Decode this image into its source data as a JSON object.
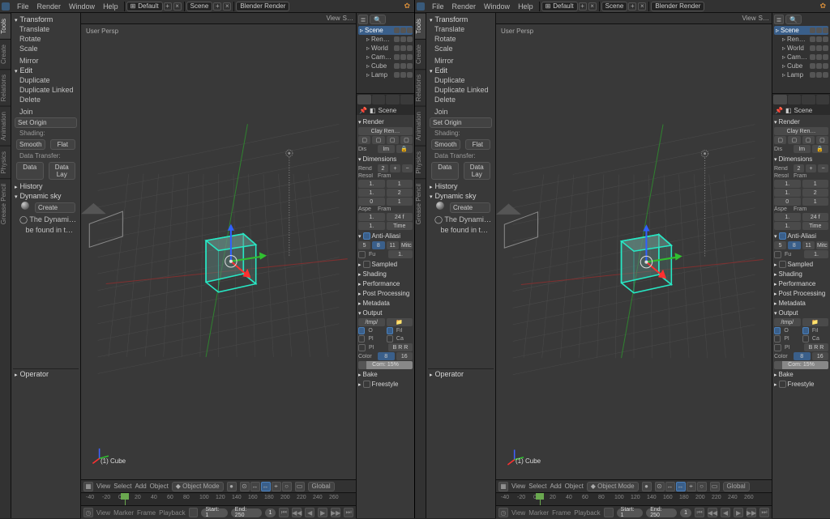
{
  "top": {
    "menus": [
      "File",
      "Render",
      "Window",
      "Help"
    ],
    "layout": "Default",
    "scene": "Scene",
    "engine": "Blender Render"
  },
  "vtabs": [
    "Tools",
    "Create",
    "Relations",
    "Animation",
    "Physics",
    "Grease Pencil"
  ],
  "toolpanel": {
    "transform": {
      "title": "Transform",
      "items": [
        "Translate",
        "Rotate",
        "Scale",
        "",
        "Mirror"
      ]
    },
    "edit": {
      "title": "Edit",
      "items": [
        "Duplicate",
        "Duplicate Linked",
        "Delete",
        "",
        "Join"
      ],
      "setorigin": "Set Origin",
      "shading_label": "Shading:",
      "shading": [
        "Smooth",
        "Flat"
      ],
      "datatransfer": "Data Transfer:",
      "dt": [
        "Data",
        "Data Lay"
      ]
    },
    "history": "History",
    "dynsky": {
      "title": "Dynamic sky",
      "create": "Create",
      "note1": "The Dynamic …",
      "note2": "be found in th…"
    },
    "operator": "Operator"
  },
  "viewport": {
    "hdr_left": "",
    "hdr_view": "View",
    "hdr_right": "",
    "persp": "User Persp",
    "obj": "(1) Cube",
    "footer_menus": [
      "View",
      "Select",
      "Add",
      "Object"
    ],
    "mode": "Object Mode",
    "orient": "Global"
  },
  "timeline": {
    "ticks": [
      -40,
      -20,
      0,
      20,
      40,
      60,
      80,
      100,
      120,
      140,
      160,
      180,
      200,
      220,
      240,
      260
    ],
    "menus": [
      "View",
      "Marker",
      "Frame",
      "Playback"
    ],
    "start_label": "Start:",
    "start": 1,
    "end_label": "End:",
    "end": 250,
    "frame": 1,
    "cursor_pct": 16
  },
  "outliner": {
    "items": [
      {
        "name": "Scene",
        "icon": "scene",
        "sel": true
      },
      {
        "name": "RenderLayers",
        "icon": "layers",
        "indent": 1
      },
      {
        "name": "World",
        "icon": "world",
        "indent": 1
      },
      {
        "name": "Camera",
        "icon": "cam",
        "indent": 1
      },
      {
        "name": "Cube",
        "icon": "mesh",
        "indent": 1
      },
      {
        "name": "Lamp",
        "icon": "lamp",
        "indent": 1
      }
    ]
  },
  "props": {
    "breadcrumb": "Scene",
    "render": {
      "title": "Render",
      "preset": "Clay Ren…",
      "disp_label": "Dis",
      "disp_val": "Im"
    },
    "dimensions": {
      "title": "Dimensions",
      "rend_label": "Rend",
      "rend_val": "2",
      "cols": [
        "Resol",
        "Fram"
      ],
      "rows": [
        [
          "1.",
          "1"
        ],
        [
          "1.",
          "2"
        ],
        [
          "0",
          "1"
        ]
      ],
      "aspe": "Aspe",
      "fram": "Fram",
      "rows2": [
        [
          "1.",
          "24 f"
        ],
        [
          "1.",
          "Time"
        ]
      ]
    },
    "aa": {
      "title": "Anti-Aliasi",
      "on": true,
      "samples": [
        "5",
        "8",
        "11"
      ],
      "filter": "Mitc",
      "fu": "Fu",
      "fuval": "1."
    },
    "panels": [
      "Sampled",
      "Shading",
      "Performance",
      "Post Processing",
      "Metadata"
    ],
    "output": {
      "title": "Output",
      "path": "/tmp/",
      "o": "O",
      "fil": "Fil",
      "pl": "Pl",
      "ca": "Ca",
      "brr": "B R R",
      "color_label": "Color",
      "color_val": "8",
      "color_b": "16",
      "comp": "Com:  15%"
    },
    "bake": "Bake",
    "freestyle": "Freestyle"
  }
}
